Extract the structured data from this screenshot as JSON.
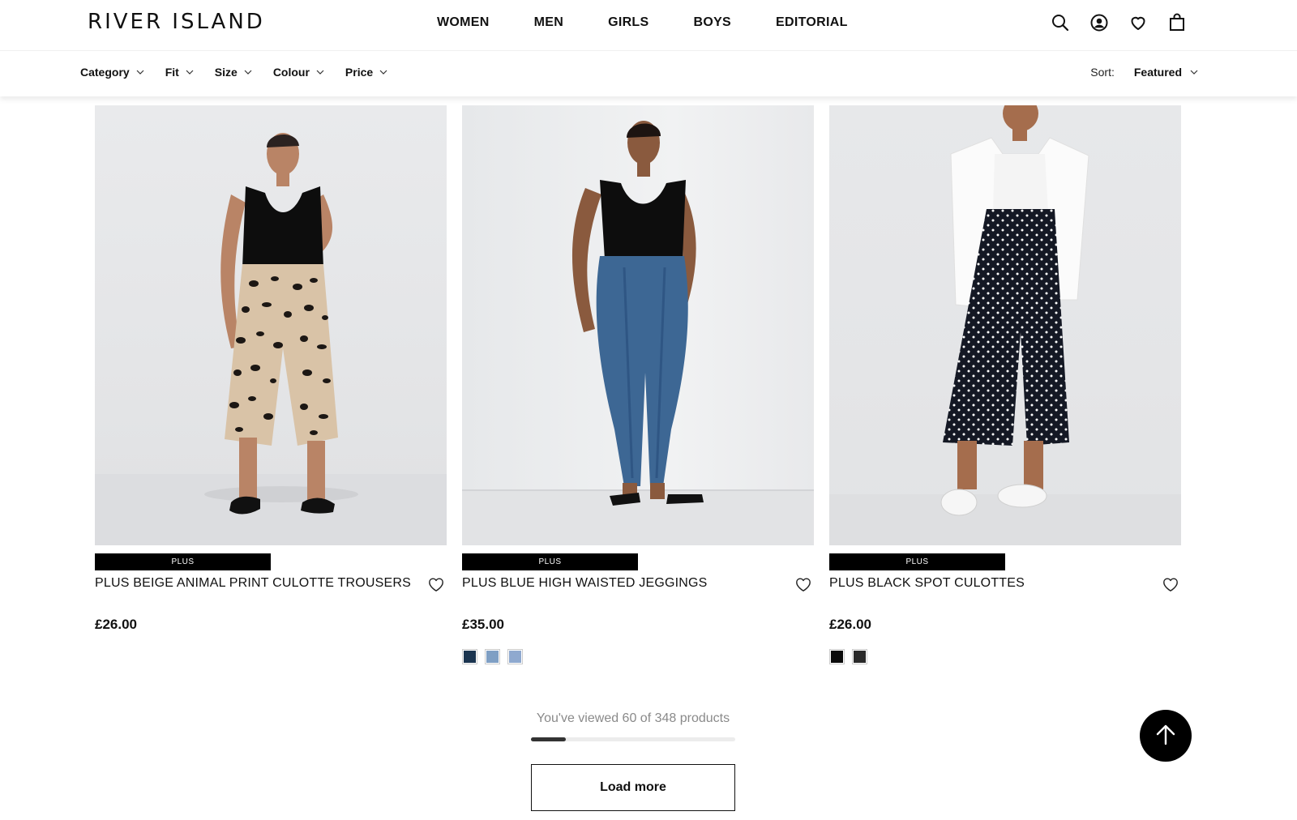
{
  "header": {
    "logo": "RIVER ISLAND",
    "nav": [
      "WOMEN",
      "MEN",
      "GIRLS",
      "BOYS",
      "EDITORIAL"
    ],
    "icons": [
      "search-icon",
      "account-icon",
      "wishlist-icon",
      "bag-icon"
    ]
  },
  "filters": {
    "items": [
      "Category",
      "Fit",
      "Size",
      "Colour",
      "Price"
    ],
    "sort_label": "Sort:",
    "sort_value": "Featured"
  },
  "products": [
    {
      "badge": "PLUS",
      "title": "PLUS BEIGE ANIMAL PRINT CULOTTE TROUSERS",
      "price": "£26.00",
      "swatches": []
    },
    {
      "badge": "PLUS",
      "title": "PLUS BLUE HIGH WAISTED JEGGINGS",
      "price": "£35.00",
      "swatches": [
        "#1b3550",
        "#7f9fc4",
        "#8fa9cf"
      ]
    },
    {
      "badge": "PLUS",
      "title": "PLUS BLACK SPOT CULOTTES",
      "price": "£26.00",
      "swatches": [
        "#0b0b0b",
        "#2a2a2a"
      ]
    }
  ],
  "progress": {
    "text": "You've viewed 60 of 348 products",
    "viewed": 60,
    "total": 348
  },
  "load_more_label": "Load more",
  "colors": {
    "accent": "#000000",
    "muted_text": "#8a8a8a"
  }
}
